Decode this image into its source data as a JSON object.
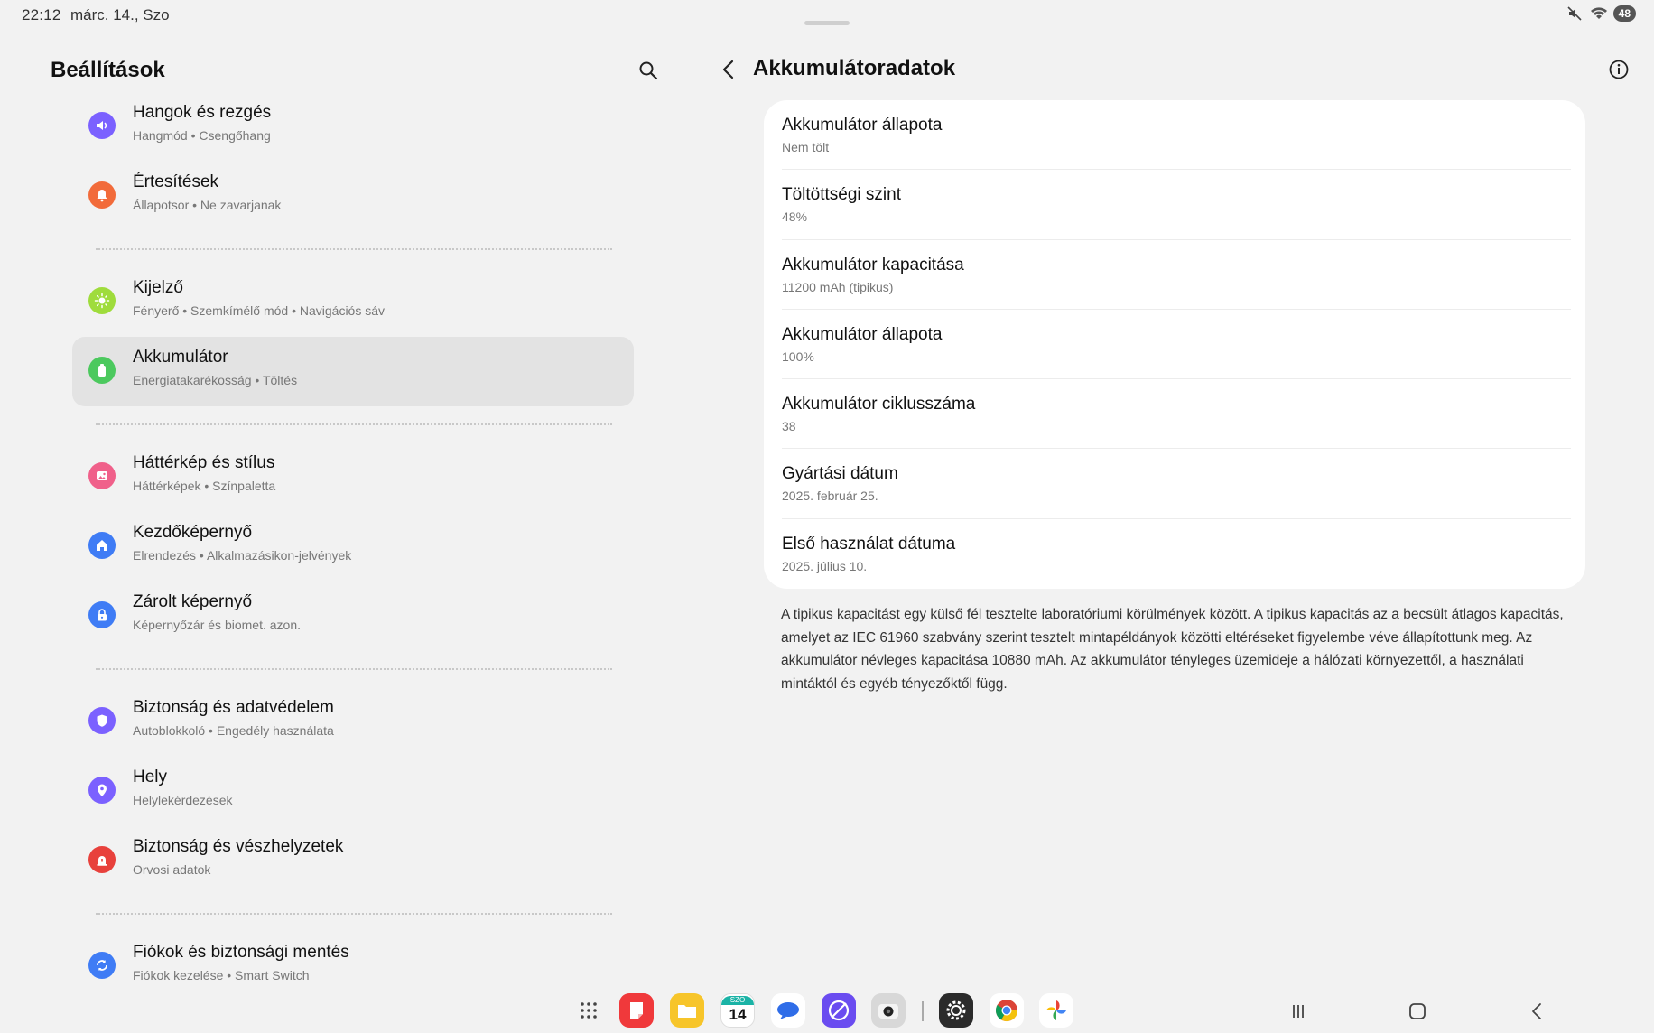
{
  "status_bar": {
    "time": "22:12",
    "date": "márc. 14., Szo",
    "battery": "48",
    "icons": [
      "mute-icon",
      "wifi-icon",
      "battery-icon"
    ]
  },
  "left": {
    "title": "Beállítások",
    "search_icon": "search-icon",
    "items": [
      {
        "title": "Hangok és rezgés",
        "sub": "Hangmód  •  Csengőhang",
        "icon": "sound-icon",
        "color": "#7b61ff"
      },
      {
        "title": "Értesítések",
        "sub": "Állapotsor  •  Ne zavarjanak",
        "icon": "bell-icon",
        "color": "#f26b3a"
      },
      {
        "title": "Kijelző",
        "sub": "Fényerő  •  Szemkímélő mód  •  Navigációs sáv",
        "icon": "sun-icon",
        "color": "#9fdc3c"
      },
      {
        "title": "Akkumulátor",
        "sub": "Energiatakarékosság  •  Töltés",
        "icon": "battery-icon",
        "color": "#4cc95e"
      },
      {
        "title": "Háttérkép és stílus",
        "sub": "Háttérképek  •  Színpaletta",
        "icon": "image-icon",
        "color": "#f0608a"
      },
      {
        "title": "Kezdőképernyő",
        "sub": "Elrendezés  •  Alkalmazásikon-jelvények",
        "icon": "home-icon",
        "color": "#3f7cf5"
      },
      {
        "title": "Zárolt képernyő",
        "sub": "Képernyőzár és biomet. azon.",
        "icon": "lock-icon",
        "color": "#3f7cf5"
      },
      {
        "title": "Biztonság és adatvédelem",
        "sub": "Autoblokkoló  •  Engedély használata",
        "icon": "shield-icon",
        "color": "#7b61ff"
      },
      {
        "title": "Hely",
        "sub": "Helylekérdezések",
        "icon": "location-icon",
        "color": "#7b61ff"
      },
      {
        "title": "Biztonság és vészhelyzetek",
        "sub": "Orvosi adatok",
        "icon": "alert-icon",
        "color": "#e8413c"
      },
      {
        "title": "Fiókok és biztonsági mentés",
        "sub": "Fiókok kezelése  •  Smart Switch",
        "icon": "sync-icon",
        "color": "#3f7cf5"
      }
    ]
  },
  "right": {
    "title": "Akkumulátoradatok",
    "back_icon": "back-arrow-icon",
    "info_icon": "info-icon",
    "rows": [
      {
        "title": "Akkumulátor állapota",
        "value": "Nem tölt"
      },
      {
        "title": "Töltöttségi szint",
        "value": "48%"
      },
      {
        "title": "Akkumulátor kapacitása",
        "value": "11200 mAh (tipikus)"
      },
      {
        "title": "Akkumulátor állapota",
        "value": "100%"
      },
      {
        "title": "Akkumulátor ciklusszáma",
        "value": "38"
      },
      {
        "title": "Gyártási dátum",
        "value": "2025. február 25."
      },
      {
        "title": "Első használat dátuma",
        "value": "2025. július 10."
      }
    ],
    "note": "A tipikus kapacitást egy külső fél tesztelte laboratóriumi körülmények között. A tipikus kapacitás az a becsült átlagos kapacitás, amelyet az IEC 61960 szabvány szerint tesztelt mintapéldányok közötti eltéréseket figyelembe véve állapítottunk meg. Az akkumulátor névleges kapacitása 10880 mAh. Az akkumulátor tényleges üzemideje a hálózati környezettől, a használati mintáktól és egyéb tényezőktől függ."
  },
  "dock": {
    "apps": [
      {
        "name": "app-drawer-icon",
        "color": "#f2f2f2"
      },
      {
        "name": "notes-app-icon",
        "color": "#f0393b"
      },
      {
        "name": "files-app-icon",
        "color": "#f7c52a"
      },
      {
        "name": "calendar-app-icon",
        "color": "#ffffff",
        "label_top": "SZO",
        "label": "14"
      },
      {
        "name": "messages-app-icon",
        "color": "#ffffff"
      },
      {
        "name": "browser-app-icon",
        "color": "#6a4cf0"
      },
      {
        "name": "camera-app-icon",
        "color": "#d8d8d8"
      },
      {
        "name": "settings-app-icon",
        "color": "#2b2b2b"
      },
      {
        "name": "chrome-app-icon",
        "color": "#ffffff"
      },
      {
        "name": "photos-app-icon",
        "color": "#ffffff"
      }
    ],
    "nav": [
      "recents-icon",
      "home-icon",
      "back-icon"
    ]
  }
}
